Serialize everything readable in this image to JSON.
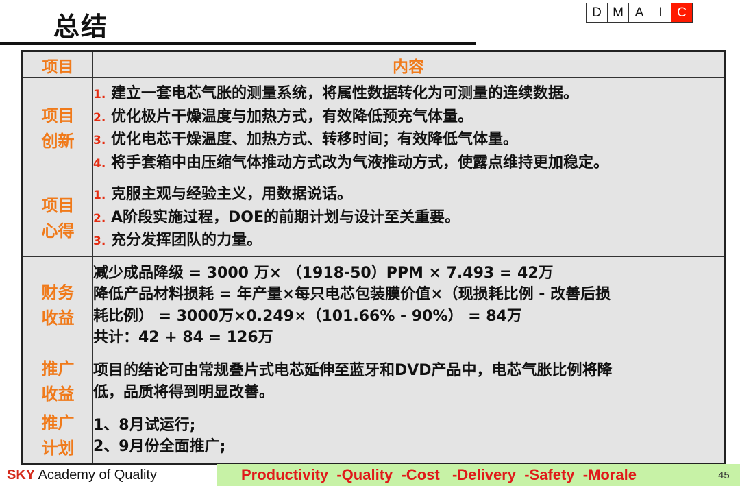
{
  "header": {
    "title": "总结",
    "dmaic": [
      "D",
      "M",
      "A",
      "I",
      "C"
    ],
    "dmaic_active": "C",
    "accent": "#ff1a00"
  },
  "table": {
    "headers": [
      "项目",
      "内容"
    ],
    "rows": [
      {
        "label": [
          "项目",
          "创新"
        ],
        "items": [
          {
            "n": "1.",
            "text": "建立一套电芯气胀的测量系统，将属性数据转化为可测量的连续数据。"
          },
          {
            "n": "2.",
            "text": "优化极片干燥温度与加热方式，有效降低预充气体量。"
          },
          {
            "n": "3.",
            "text": "优化电芯干燥温度、加热方式、转移时间；有效降低气体量。"
          },
          {
            "n": "4.",
            "text": "将手套箱中由压缩气体推动方式改为气液推动方式，使露点维持更加稳定。"
          }
        ]
      },
      {
        "label": [
          "项目",
          "心得"
        ],
        "items": [
          {
            "n": "1.",
            "text": "克服主观与经验主义，用数据说话。"
          },
          {
            "n": "2.",
            "text": "A阶段实施过程，DOE的前期计划与设计至关重要。"
          },
          {
            "n": "3.",
            "text": "充分发挥团队的力量。"
          }
        ]
      },
      {
        "label": [
          "财务",
          "收益"
        ],
        "lines": [
          "减少成品降级 = 3000 万×  （1918-50）PPM × 7.493  =  42万",
          "降低产品材料损耗 = 年产量×每只电芯包装膜价值×（现损耗比例 - 改善后损",
          "耗比例） = 3000万×0.249×（101.66% - 90%） = 84万",
          "共计：42 + 84 = 126万"
        ]
      },
      {
        "label": [
          "推广",
          "收益"
        ],
        "lines": [
          "项目的结论可由常规叠片式电芯延伸至蓝牙和DVD产品中，电芯气胀比例将降",
          "低，品质将得到明显改善。"
        ]
      },
      {
        "label": [
          "推广",
          "计划"
        ],
        "lines": [
          "1、8月试运行;",
          "2、9月份全面推广;"
        ]
      }
    ],
    "header_color": "#f07a1a",
    "number_color": "#e52d12"
  },
  "footer": {
    "brand": "SKY",
    "brand_rest": "Academy of Quality",
    "slogan": "Productivity  -Quality  -Cost   -Delivery  -Safety  -Morale",
    "page": "45",
    "slogan_bg": "#c7f2a6"
  }
}
